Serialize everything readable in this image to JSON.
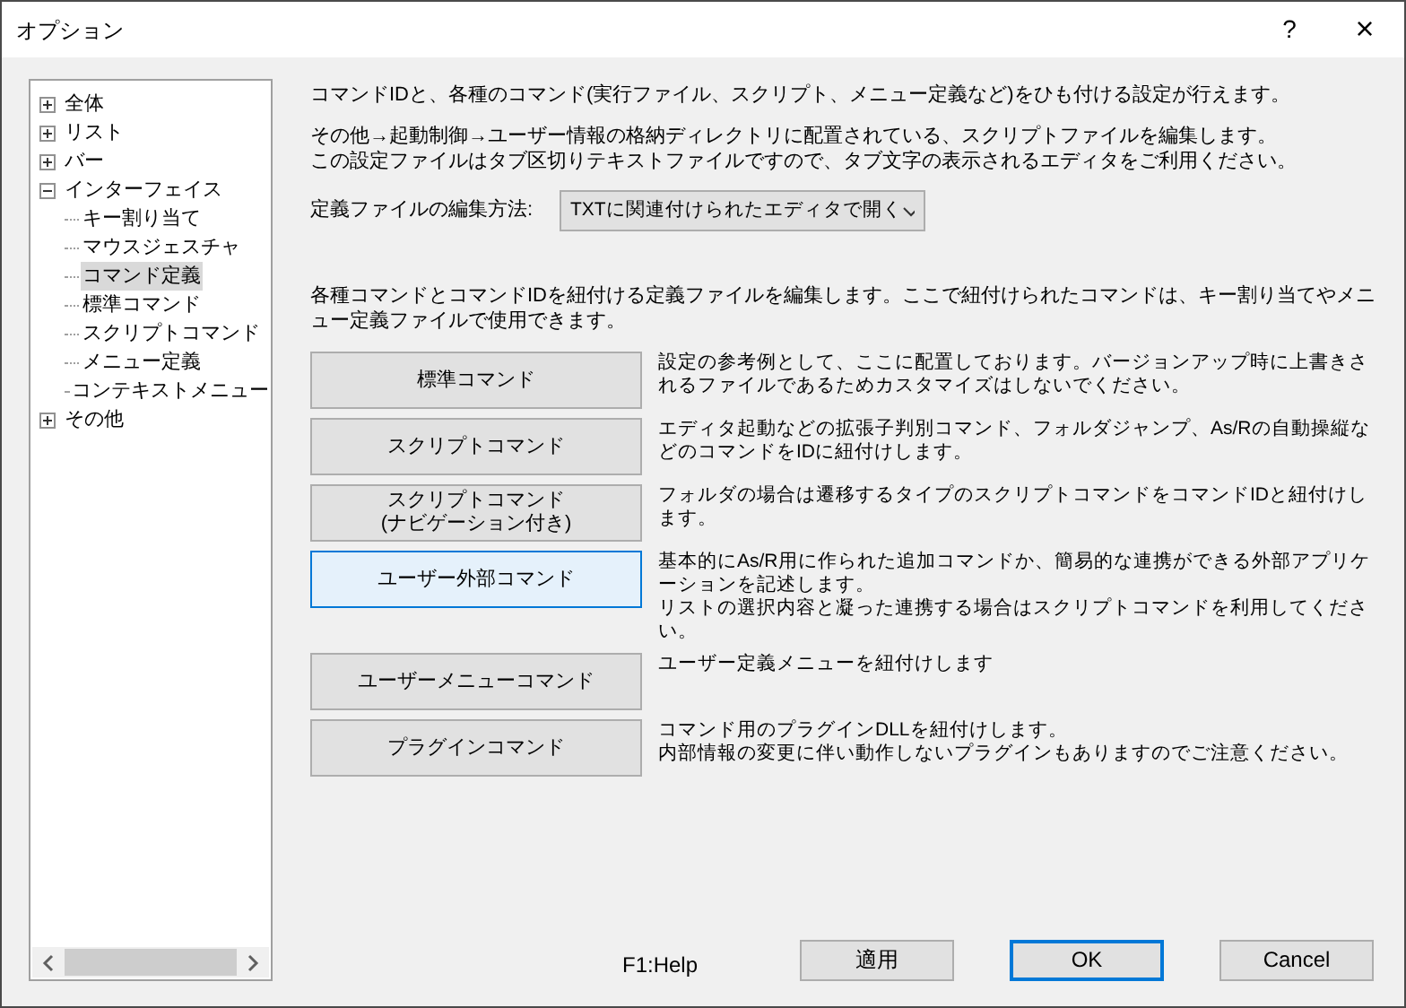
{
  "window": {
    "title": "オプション",
    "help": "?",
    "close": "×"
  },
  "tree": [
    {
      "label": "全体",
      "expanded": false,
      "selected": false
    },
    {
      "label": "リスト",
      "expanded": false,
      "selected": false
    },
    {
      "label": "バー",
      "expanded": false,
      "selected": false
    },
    {
      "label": "インターフェイス",
      "expanded": true,
      "selected": false,
      "children": [
        {
          "label": "キー割り当て",
          "selected": false
        },
        {
          "label": "マウスジェスチャ",
          "selected": false
        },
        {
          "label": "コマンド定義",
          "selected": true
        },
        {
          "label": "標準コマンド",
          "selected": false
        },
        {
          "label": "スクリプトコマンド",
          "selected": false
        },
        {
          "label": "メニュー定義",
          "selected": false
        },
        {
          "label": "コンテキストメニュー",
          "selected": false
        }
      ]
    },
    {
      "label": "その他",
      "expanded": false,
      "selected": false
    }
  ],
  "intro": "コマンドIDと、各種のコマンド(実行ファイル、スクリプト、メニュー定義など)をひも付ける設定が行えます。",
  "note": [
    "その他→起動制御→ユーザー情報の格納ディレクトリに配置されている、スクリプトファイルを編集します。",
    "この設定ファイルはタブ区切りテキストファイルですので、タブ文字の表示されるエディタをご利用ください。"
  ],
  "edit_method": {
    "label": "定義ファイルの編集方法:",
    "value": "TXTに関連付けられたエディタで開く"
  },
  "commands_intro": "各種コマンドとコマンドIDを紐付ける定義ファイルを編集します。ここで紐付けられたコマンドは、キー割り当てやメニュー定義ファイルで使用できます。",
  "commands": [
    {
      "button": [
        "標準コマンド"
      ],
      "focused": false,
      "description": [
        "設定の参考例として、ここに配置しております。バージョンアップ時に上書きされるファイルであるためカスタマイズはしないでください。"
      ]
    },
    {
      "button": [
        "スクリプトコマンド"
      ],
      "focused": false,
      "description": [
        "エディタ起動などの拡張子判別コマンド、フォルダジャンプ、As/Rの自動操縦などのコマンドをIDに紐付けします。"
      ]
    },
    {
      "button": [
        "スクリプトコマンド",
        "(ナビゲーション付き)"
      ],
      "focused": false,
      "description": [
        "フォルダの場合は遷移するタイプのスクリプトコマンドをコマンドIDと紐付けします。"
      ]
    },
    {
      "button": [
        "ユーザー外部コマンド"
      ],
      "focused": true,
      "description": [
        "基本的にAs/R用に作られた追加コマンドか、簡易的な連携ができる外部アプリケーションを記述します。",
        "リストの選択内容と凝った連携する場合はスクリプトコマンドを利用してください。"
      ]
    },
    {
      "button": [
        "ユーザーメニューコマンド"
      ],
      "focused": false,
      "description": [
        "ユーザー定義メニューを紐付けします"
      ]
    },
    {
      "button": [
        "プラグインコマンド"
      ],
      "focused": false,
      "description": [
        "コマンド用のプラグインDLLを紐付けします。",
        "内部情報の変更に伴い動作しないプラグインもありますのでご注意ください。"
      ]
    }
  ],
  "help_hint": "F1:Help",
  "buttons": [
    {
      "label": "適用",
      "default": false
    },
    {
      "label": "OK",
      "default": true
    },
    {
      "label": "Cancel",
      "default": false
    }
  ]
}
